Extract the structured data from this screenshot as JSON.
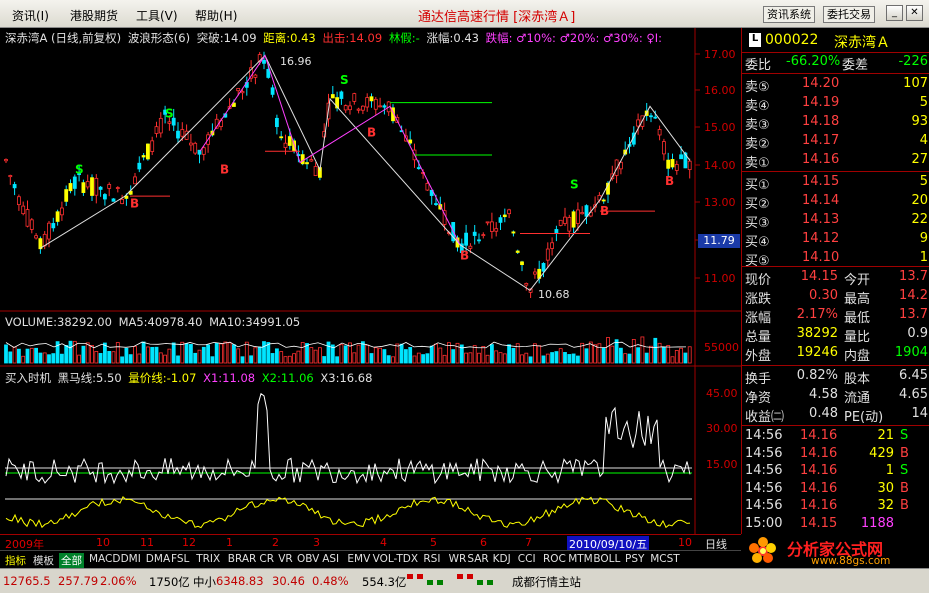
{
  "menu": {
    "items": [
      "资讯(I)",
      "港股期货",
      "工具(V)",
      "帮助(H)"
    ],
    "title": "通达信高速行情 [深赤湾Ａ]",
    "buttons": [
      "资讯系统",
      "委托交易"
    ]
  },
  "main_chart": {
    "info": {
      "name": "深赤湾A (日线,前复权)",
      "indicator": "波浪形态(6)",
      "break": "突破:14.09",
      "distance": "距离:0.43",
      "exit": "出击:14.09",
      "fake": "林假:-",
      "rise": "涨幅:0.43",
      "extras": "跌幅: ♂10%: ♂20%: ♂30%: ♀I:"
    },
    "y_ticks": [
      "17.00",
      "16.00",
      "15.00",
      "14.00",
      "13.00",
      "12.00",
      "11.00"
    ],
    "current_price_tag": "11.79",
    "high_label": "16.96",
    "low_label": "10.68"
  },
  "volume_chart": {
    "info": {
      "title": "VOLUME:38292.00",
      "ma5": "MA5:40978.40",
      "ma10": "MA10:34991.05"
    },
    "y_tick": "55000"
  },
  "signal_chart": {
    "info": {
      "title": "买入时机",
      "black_horse": "黑马线:5.50",
      "price_line": "量价线:-1.07",
      "x1": "X1:11.08",
      "x2": "X2:11.06",
      "x3": "X3:16.68"
    },
    "y_ticks": [
      "45.00",
      "30.00",
      "15.00"
    ]
  },
  "date_axis": {
    "ticks": [
      "2009年",
      "10",
      "11",
      "12",
      "1",
      "2",
      "3",
      "4",
      "5",
      "6",
      "7",
      "10"
    ],
    "highlight": "2010/09/10/五",
    "right": "日线"
  },
  "tabs": [
    "指标",
    "模板",
    "全部",
    "MACD",
    "DMI",
    "DMA",
    "FSL",
    "TRIX",
    "BRAR",
    "CR",
    "VR",
    "OBV",
    "ASI",
    "EMV",
    "VOL-TDX",
    "RSI",
    "WR",
    "SAR",
    "KDJ",
    "CCI",
    "ROC",
    "MTM",
    "BOLL",
    "PSY",
    "MCST"
  ],
  "statusbar": {
    "index1": "12765.5",
    "index1_change": "257.79",
    "index1_pct": "2.06%",
    "index1_amount": "1750亿",
    "index2_name": "中小",
    "index2": "6348.83",
    "index2_change": "30.46",
    "index2_pct": "0.48%",
    "index2_amount": "554.3亿",
    "station": "成都行情主站"
  },
  "quote_panel": {
    "code": "000022",
    "name": "深赤湾Ａ",
    "ratio_label": "委比",
    "ratio": "-66.20%",
    "diff_label": "委差",
    "diff": "-226",
    "sells": [
      {
        "label": "卖⑤",
        "price": "14.20",
        "vol": "107"
      },
      {
        "label": "卖④",
        "price": "14.19",
        "vol": "5"
      },
      {
        "label": "卖③",
        "price": "14.18",
        "vol": "93"
      },
      {
        "label": "卖②",
        "price": "14.17",
        "vol": "4"
      },
      {
        "label": "卖①",
        "price": "14.16",
        "vol": "27"
      }
    ],
    "buys": [
      {
        "label": "买①",
        "price": "14.15",
        "vol": "5"
      },
      {
        "label": "买②",
        "price": "14.14",
        "vol": "20"
      },
      {
        "label": "买③",
        "price": "14.13",
        "vol": "22"
      },
      {
        "label": "买④",
        "price": "14.12",
        "vol": "9"
      },
      {
        "label": "买⑤",
        "price": "14.10",
        "vol": "1"
      }
    ],
    "stats": [
      {
        "l1": "现价",
        "v1": "14.15",
        "l2": "今开",
        "v2": "13.7"
      },
      {
        "l1": "涨跌",
        "v1": "0.30",
        "l2": "最高",
        "v2": "14.2"
      },
      {
        "l1": "涨幅",
        "v1": "2.17%",
        "l2": "最低",
        "v2": "13.7"
      },
      {
        "l1": "总量",
        "v1": "38292",
        "l2": "量比",
        "v2": "0.9"
      },
      {
        "l1": "外盘",
        "v1": "19246",
        "l2": "内盘",
        "v2": "1904"
      }
    ],
    "stats2": [
      {
        "l1": "换手",
        "v1": "0.82%",
        "l2": "股本",
        "v2": "6.45"
      },
      {
        "l1": "净资",
        "v1": "4.58",
        "l2": "流通",
        "v2": "4.65"
      },
      {
        "l1": "收益㈡",
        "v1": "0.48",
        "l2": "PE(动)",
        "v2": "14"
      }
    ],
    "ticks": [
      {
        "time": "14:56",
        "price": "14.16",
        "vol": "21",
        "side": "S"
      },
      {
        "time": "14:56",
        "price": "14.16",
        "vol": "429",
        "side": "B"
      },
      {
        "time": "14:56",
        "price": "14.16",
        "vol": "1",
        "side": "S"
      },
      {
        "time": "14:56",
        "price": "14.16",
        "vol": "30",
        "side": "B"
      },
      {
        "time": "14:56",
        "price": "14.16",
        "vol": "32",
        "side": "B"
      },
      {
        "time": "15:00",
        "price": "14.15",
        "vol": "1188",
        "side": ""
      }
    ]
  },
  "watermark": {
    "text": "分析家公式网",
    "url": "www.88gs.com"
  },
  "colors": {
    "up": "#ff4040",
    "down": "#00ffff",
    "green": "#00ff00",
    "yellow": "#ffff00",
    "axis": "#a00000"
  }
}
